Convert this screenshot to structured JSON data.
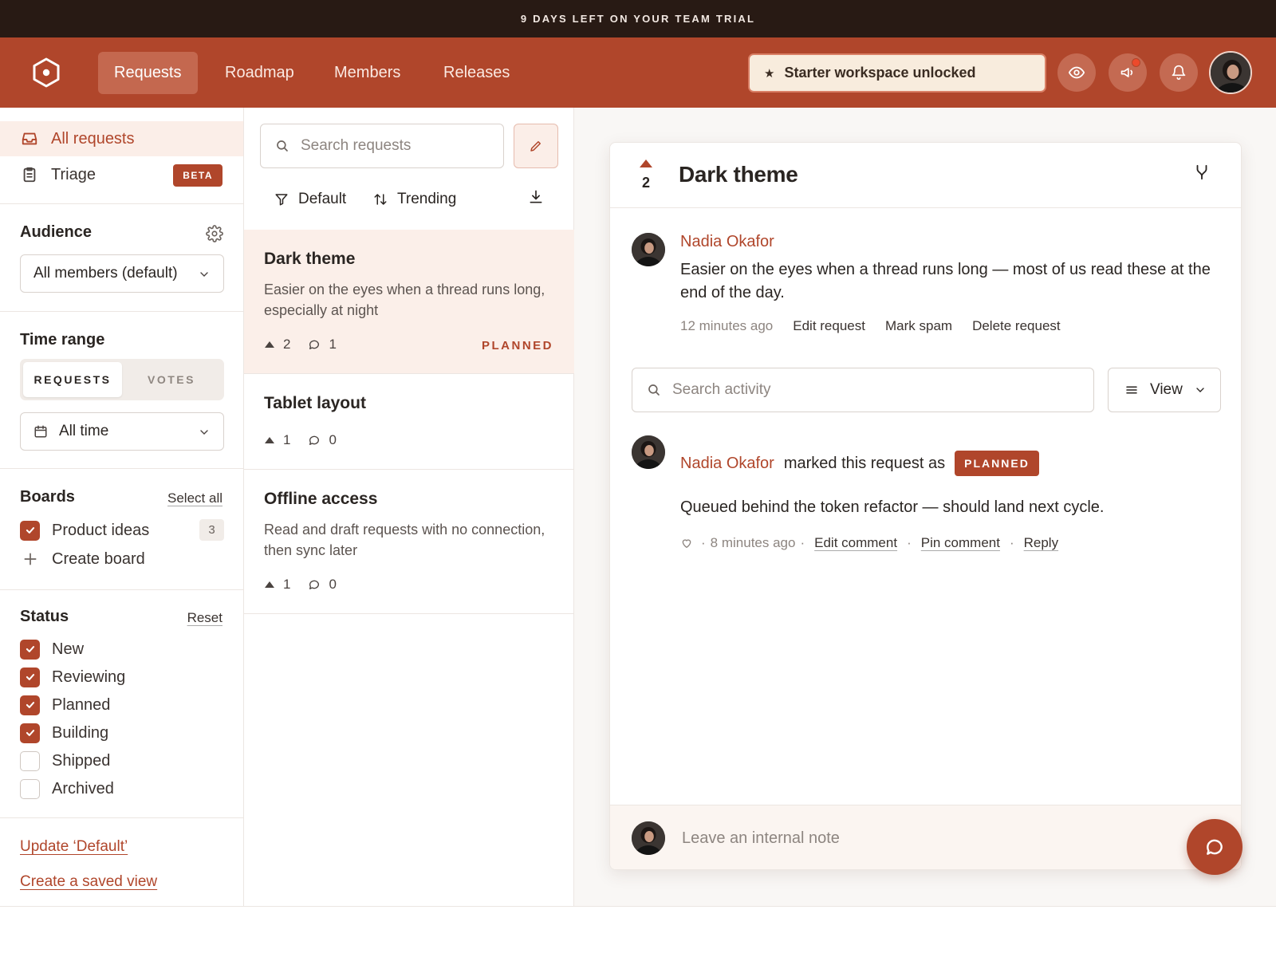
{
  "banner": {
    "text": "9 DAYS LEFT ON YOUR TEAM TRIAL"
  },
  "header": {
    "nav": [
      {
        "label": "Requests",
        "active": true
      },
      {
        "label": "Roadmap",
        "active": false
      },
      {
        "label": "Members",
        "active": false
      },
      {
        "label": "Releases",
        "active": false
      }
    ],
    "promo_label": "Starter workspace unlocked",
    "icons": [
      "eye-icon",
      "megaphone-icon",
      "bell-icon"
    ],
    "accent_color": "#b0462b"
  },
  "sidebar": {
    "nav": [
      {
        "label": "All requests",
        "icon": "inbox-icon",
        "active": true
      },
      {
        "label": "Triage",
        "icon": "clipboard-icon",
        "badge": "BETA"
      }
    ],
    "audience": {
      "title": "Audience",
      "selected": "All members (default)"
    },
    "time_range": {
      "title": "Time range",
      "segments": [
        "REQUESTS",
        "VOTES"
      ],
      "active_segment": "REQUESTS",
      "selected": "All time"
    },
    "boards": {
      "title": "Boards",
      "select_all": "Select all",
      "items": [
        {
          "label": "Product ideas",
          "checked": true,
          "count": "3"
        }
      ],
      "create_label": "Create board"
    },
    "status": {
      "title": "Status",
      "reset": "Reset",
      "items": [
        {
          "label": "New",
          "checked": true
        },
        {
          "label": "Reviewing",
          "checked": true
        },
        {
          "label": "Planned",
          "checked": true
        },
        {
          "label": "Building",
          "checked": true
        },
        {
          "label": "Shipped",
          "checked": false
        },
        {
          "label": "Archived",
          "checked": false
        }
      ]
    },
    "footer": {
      "update_label": "Update ‘Default’",
      "save_label": "Create a saved view"
    }
  },
  "list": {
    "search_placeholder": "Search requests",
    "filter_label": "Default",
    "sort_label": "Trending",
    "cards": [
      {
        "title": "Dark theme",
        "description": "Easier on the eyes when a thread runs long, especially at night",
        "votes": "2",
        "comments": "1",
        "status": "PLANNED",
        "active": true
      },
      {
        "title": "Tablet layout",
        "description": "",
        "votes": "1",
        "comments": "0",
        "status": "",
        "active": false
      },
      {
        "title": "Offline access",
        "description": "Read and draft requests with no connection, then sync later",
        "votes": "1",
        "comments": "0",
        "status": "",
        "active": false
      }
    ]
  },
  "detail": {
    "votes": "2",
    "title": "Dark theme",
    "post": {
      "author": "Nadia Okafor",
      "body": "Easier on the eyes when a thread runs long — most of us read these at the end of the day.",
      "time": "12 minutes ago",
      "actions": [
        "Edit request",
        "Mark spam",
        "Delete request"
      ]
    },
    "activity_search_placeholder": "Search activity",
    "view_label": "View",
    "activity": {
      "author": "Nadia Okafor",
      "action_text": "marked this request as",
      "status": "PLANNED",
      "comment": "Queued behind the token refactor — should land next cycle.",
      "time": "8 minutes ago",
      "actions": [
        "Edit comment",
        "Pin comment",
        "Reply"
      ]
    },
    "note_placeholder": "Leave an internal note"
  }
}
